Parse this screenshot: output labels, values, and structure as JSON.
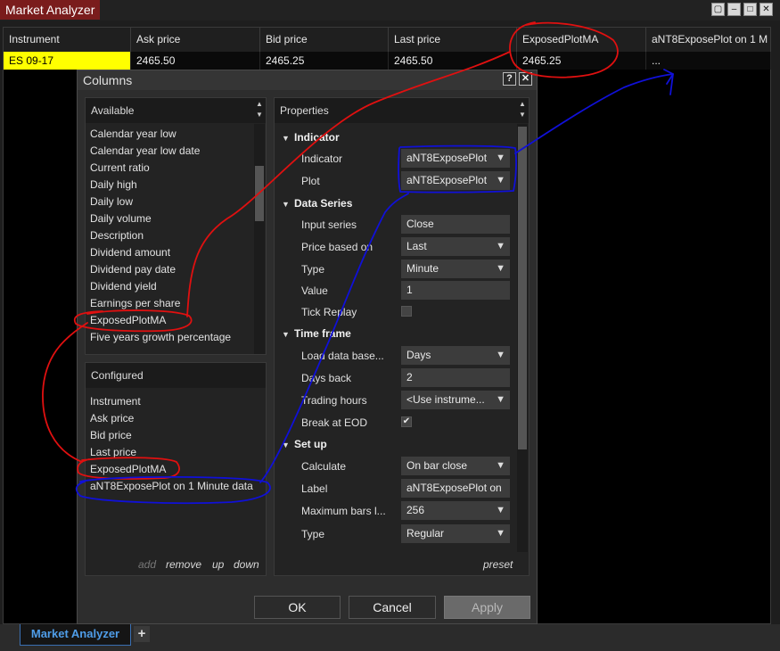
{
  "window": {
    "title": "Market Analyzer",
    "controls": {
      "restore": "▢",
      "minimize": "–",
      "maximize": "□",
      "close": "✕"
    }
  },
  "grid": {
    "columns": [
      "Instrument",
      "Ask price",
      "Bid price",
      "Last price",
      "ExposedPlotMA",
      "aNT8ExposePlot on 1 M"
    ],
    "row": [
      "ES 09-17",
      "2465.50",
      "2465.25",
      "2465.50",
      "2465.25",
      "..."
    ]
  },
  "dialog": {
    "title": "Columns",
    "help": "?",
    "close": "✕",
    "available_header": "Available",
    "available_items": [
      "Calendar year low",
      "Calendar year low date",
      "Current ratio",
      "Daily high",
      "Daily low",
      "Daily volume",
      "Description",
      "Dividend amount",
      "Dividend pay date",
      "Dividend yield",
      "Earnings per share",
      "ExposedPlotMA",
      "Five years growth percentage"
    ],
    "configured_header": "Configured",
    "configured_items": [
      "Instrument",
      "Ask price",
      "Bid price",
      "Last price",
      "ExposedPlotMA",
      "aNT8ExposePlot on 1 Minute data"
    ],
    "footer_links": {
      "add": "add",
      "remove": "remove",
      "up": "up",
      "down": "down"
    },
    "properties_header": "Properties",
    "preset": "preset",
    "sections": {
      "indicator": {
        "title": "Indicator",
        "rows": [
          {
            "label": "Indicator",
            "value": "aNT8ExposePlot"
          },
          {
            "label": "Plot",
            "value": "aNT8ExposePlot"
          }
        ]
      },
      "data_series": {
        "title": "Data Series",
        "rows": [
          {
            "label": "Input series",
            "value": "Close"
          },
          {
            "label": "Price based on",
            "value": "Last"
          },
          {
            "label": "Type",
            "value": "Minute"
          },
          {
            "label": "Value",
            "value": "1"
          },
          {
            "label": "Tick Replay",
            "value": ""
          }
        ]
      },
      "time_frame": {
        "title": "Time frame",
        "rows": [
          {
            "label": "Load data base...",
            "value": "Days"
          },
          {
            "label": "Days back",
            "value": "2"
          },
          {
            "label": "Trading hours",
            "value": "<Use instrume..."
          },
          {
            "label": "Break at EOD",
            "value": "✔"
          }
        ]
      },
      "set_up": {
        "title": "Set up",
        "rows": [
          {
            "label": "Calculate",
            "value": "On bar close"
          },
          {
            "label": "Label",
            "value": "aNT8ExposePlot on"
          },
          {
            "label": "Maximum bars l...",
            "value": "256"
          },
          {
            "label": "Type",
            "value": "Regular"
          }
        ]
      }
    },
    "buttons": {
      "ok": "OK",
      "cancel": "Cancel",
      "apply": "Apply"
    }
  },
  "tabs": {
    "active": "Market Analyzer",
    "add": "+"
  },
  "colors": {
    "accent_tab": "#4f9de8",
    "instrument_highlight": "#ffff00",
    "title_red": "#7a1c1c",
    "annotation_red": "#e01010",
    "annotation_blue": "#1010d8"
  }
}
